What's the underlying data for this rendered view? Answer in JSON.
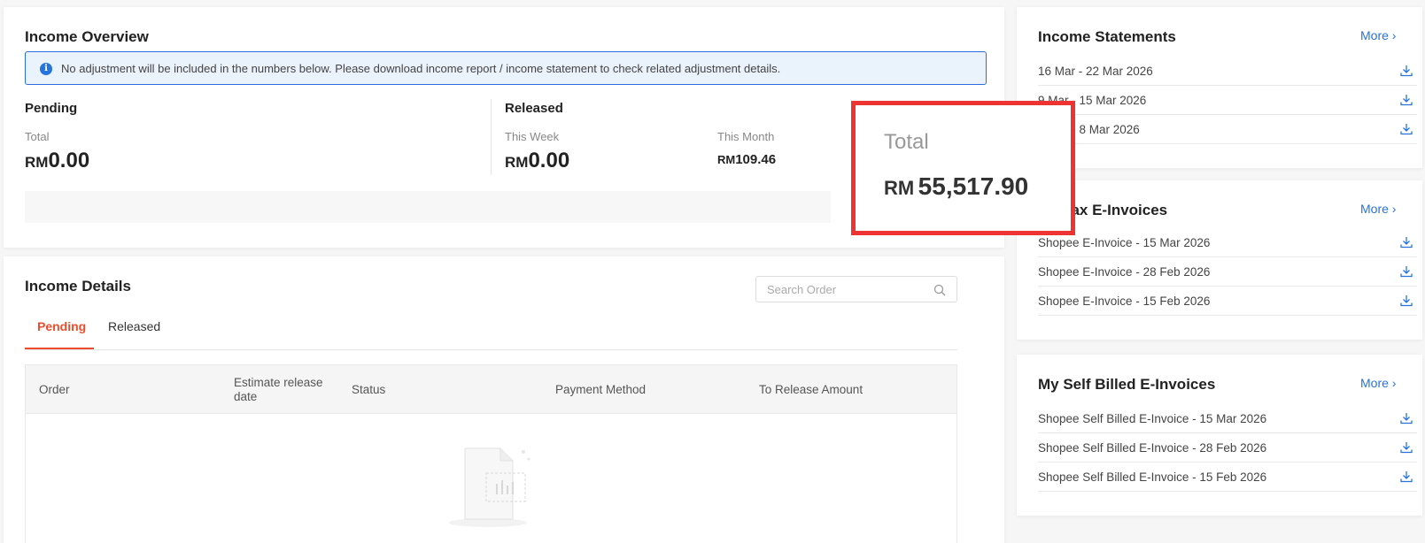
{
  "overview": {
    "title": "Income Overview",
    "notice": "No adjustment will be included in the numbers below. Please download income report / income statement to check related adjustment details.",
    "pending": {
      "label": "Pending",
      "total_label": "Total",
      "currency": "RM",
      "total_value": "0.00"
    },
    "released": {
      "label": "Released",
      "week_label": "This Week",
      "week_currency": "RM",
      "week_value": "0.00",
      "month_label": "This Month",
      "month_currency": "RM",
      "month_value": "109.46"
    },
    "highlight": {
      "label": "Total",
      "currency": "RM",
      "value": "55,517.90"
    }
  },
  "details": {
    "title": "Income Details",
    "search_placeholder": "Search Order",
    "tabs": [
      {
        "label": "Pending",
        "active": true
      },
      {
        "label": "Released",
        "active": false
      }
    ],
    "columns": [
      "Order",
      "Estimate release date",
      "Status",
      "Payment Method",
      "To Release Amount"
    ]
  },
  "statements": {
    "title": "Income Statements",
    "more": "More",
    "items": [
      "16 Mar - 22 Mar 2026",
      "9 Mar - 15 Mar 2026",
      "2 Mar - 8 Mar 2026"
    ]
  },
  "tax_invoices": {
    "title": "My Tax E-Invoices",
    "more": "More",
    "items": [
      "Shopee E-Invoice - 15 Mar 2026",
      "Shopee E-Invoice - 28 Feb 2026",
      "Shopee E-Invoice - 15 Feb 2026"
    ]
  },
  "self_billed": {
    "title": "My Self Billed E-Invoices",
    "more": "More",
    "items": [
      "Shopee Self Billed E-Invoice - 15 Mar 2026",
      "Shopee Self Billed E-Invoice - 28 Feb 2026",
      "Shopee Self Billed E-Invoice - 15 Feb 2026"
    ]
  },
  "colors": {
    "accent": "#ee4d2d",
    "link": "#2673dd",
    "highlight_border": "#ee3333"
  },
  "icons": [
    "info-icon",
    "search-icon",
    "download-icon",
    "chevron-right-icon",
    "empty-document-icon"
  ]
}
